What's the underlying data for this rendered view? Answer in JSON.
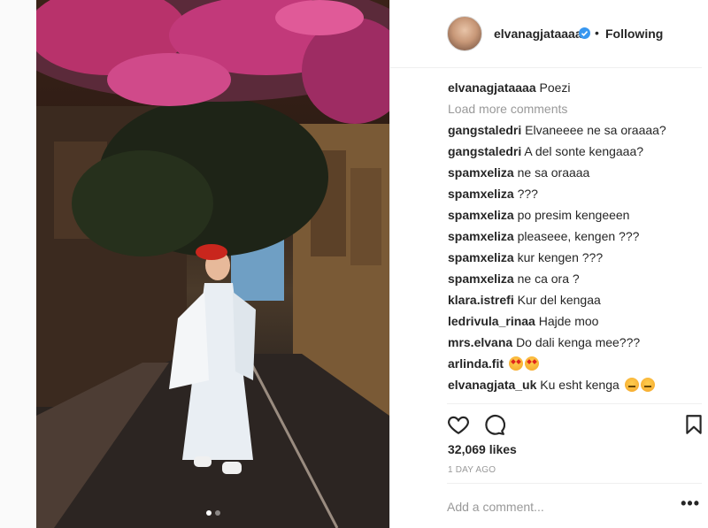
{
  "post": {
    "author": "elvanagjataaaa",
    "follow_separator": "•",
    "follow_status": "Following",
    "verified": true
  },
  "caption": {
    "user": "elvanagjataaaa",
    "text": "Poezi"
  },
  "load_more_label": "Load more comments",
  "comments": [
    {
      "user": "gangstaledri",
      "text": "Elvaneeee ne sa oraaaa?"
    },
    {
      "user": "gangstaledri",
      "text": "A del sonte kengaaa?"
    },
    {
      "user": "spamxeliza",
      "text": "ne sa oraaaa"
    },
    {
      "user": "spamxeliza",
      "text": "???"
    },
    {
      "user": "spamxeliza",
      "text": "po presim kengeeen"
    },
    {
      "user": "spamxeliza",
      "text": "pleaseee, kengen ???"
    },
    {
      "user": "spamxeliza",
      "text": "kur kengen ???"
    },
    {
      "user": "spamxeliza",
      "text": "ne ca ora ?"
    },
    {
      "user": "klara.istrefi",
      "text": "Kur del kengaa"
    },
    {
      "user": "ledrivula_rinaa",
      "text": "Hajde moo"
    },
    {
      "user": "mrs.elvana",
      "text": "Do dali kenga mee???"
    },
    {
      "user": "arlinda.fit",
      "text": "",
      "emoji": [
        "star-struck",
        "star-struck"
      ]
    },
    {
      "user": "elvanagjata_uk",
      "text": "Ku esht kenga",
      "emoji": [
        "angry",
        "angry"
      ]
    }
  ],
  "likes": "32,069 likes",
  "time_ago": "1 DAY AGO",
  "add_comment_placeholder": "Add a comment...",
  "more_label": "•••",
  "carousel": {
    "count": 2,
    "active_index": 0
  },
  "icons": {
    "like": "heart-icon",
    "comment": "comment-bubble-icon",
    "save": "bookmark-icon",
    "verified": "verified-badge-icon"
  },
  "colors": {
    "verified": "#3897f0",
    "muted": "#999999",
    "text": "#262626"
  }
}
